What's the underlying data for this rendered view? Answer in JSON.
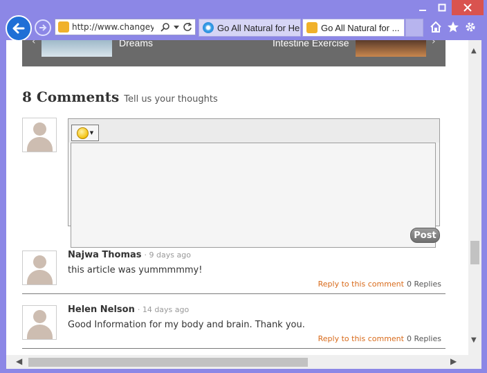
{
  "browser": {
    "address_text": "http://www.changey...",
    "tabs": [
      {
        "label": "Go All Natural for He..."
      },
      {
        "label": "Go All Natural for ..."
      }
    ]
  },
  "related": {
    "item1": "Dreams",
    "item2": "Intestine Exercise"
  },
  "comments": {
    "count_label": "8 Comments",
    "subtitle": "Tell us your thoughts",
    "post_label": "Post",
    "list": [
      {
        "author": "Najwa Thomas",
        "time": "· 9 days ago",
        "text": "this article was yummmmmy!",
        "reply_label": "Reply to this comment",
        "replies": "0 Replies"
      },
      {
        "author": "Helen Nelson",
        "time": "· 14 days ago",
        "text": "Good Information for my body and brain.  Thank you.",
        "reply_label": "Reply to this comment",
        "replies": "0 Replies"
      }
    ]
  }
}
